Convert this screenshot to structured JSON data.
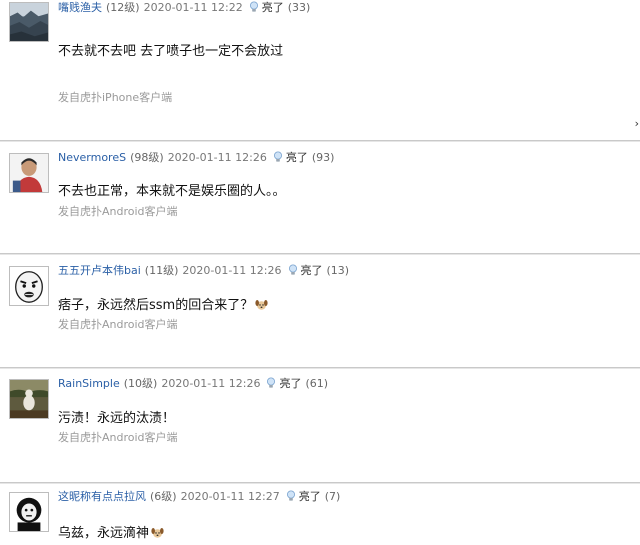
{
  "liked_label": "亮了",
  "comments": [
    {
      "user": "嘴贱渔夫",
      "level": "(12级)",
      "time": "2020-01-11 12:22",
      "count": "(33)",
      "text": "不去就不去吧 去了喷子也一定不会放过",
      "source": "发自虎扑iPhone客户端"
    },
    {
      "user": "NevermoreS",
      "level": "(98级)",
      "time": "2020-01-11 12:26",
      "count": "(93)",
      "text": "不去也正常，本来就不是娱乐圈的人。。",
      "source": "发自虎扑Android客户端"
    },
    {
      "user": "五五开卢本伟bai",
      "level": "(11级)",
      "time": "2020-01-11 12:26",
      "count": "(13)",
      "text": "痞子，永远然后ssm的回合来了？",
      "source": "发自虎扑Android客户端"
    },
    {
      "user": "RainSimple",
      "level": "(10级)",
      "time": "2020-01-11 12:26",
      "count": "(61)",
      "text": "污渍！永远的汰渍！",
      "source": "发自虎扑Android客户端"
    },
    {
      "user": "这昵称有点点拉风",
      "level": "(6级)",
      "time": "2020-01-11 12:27",
      "count": "(7)",
      "text": "乌兹，永远滴神"
    }
  ],
  "colors": {
    "username": "#2a5fa6",
    "source": "#9a9a9a",
    "divider": "#c9c9c9"
  },
  "icons": {
    "like": "lightbulb-icon",
    "emoji": "dog-emoji-icon"
  }
}
